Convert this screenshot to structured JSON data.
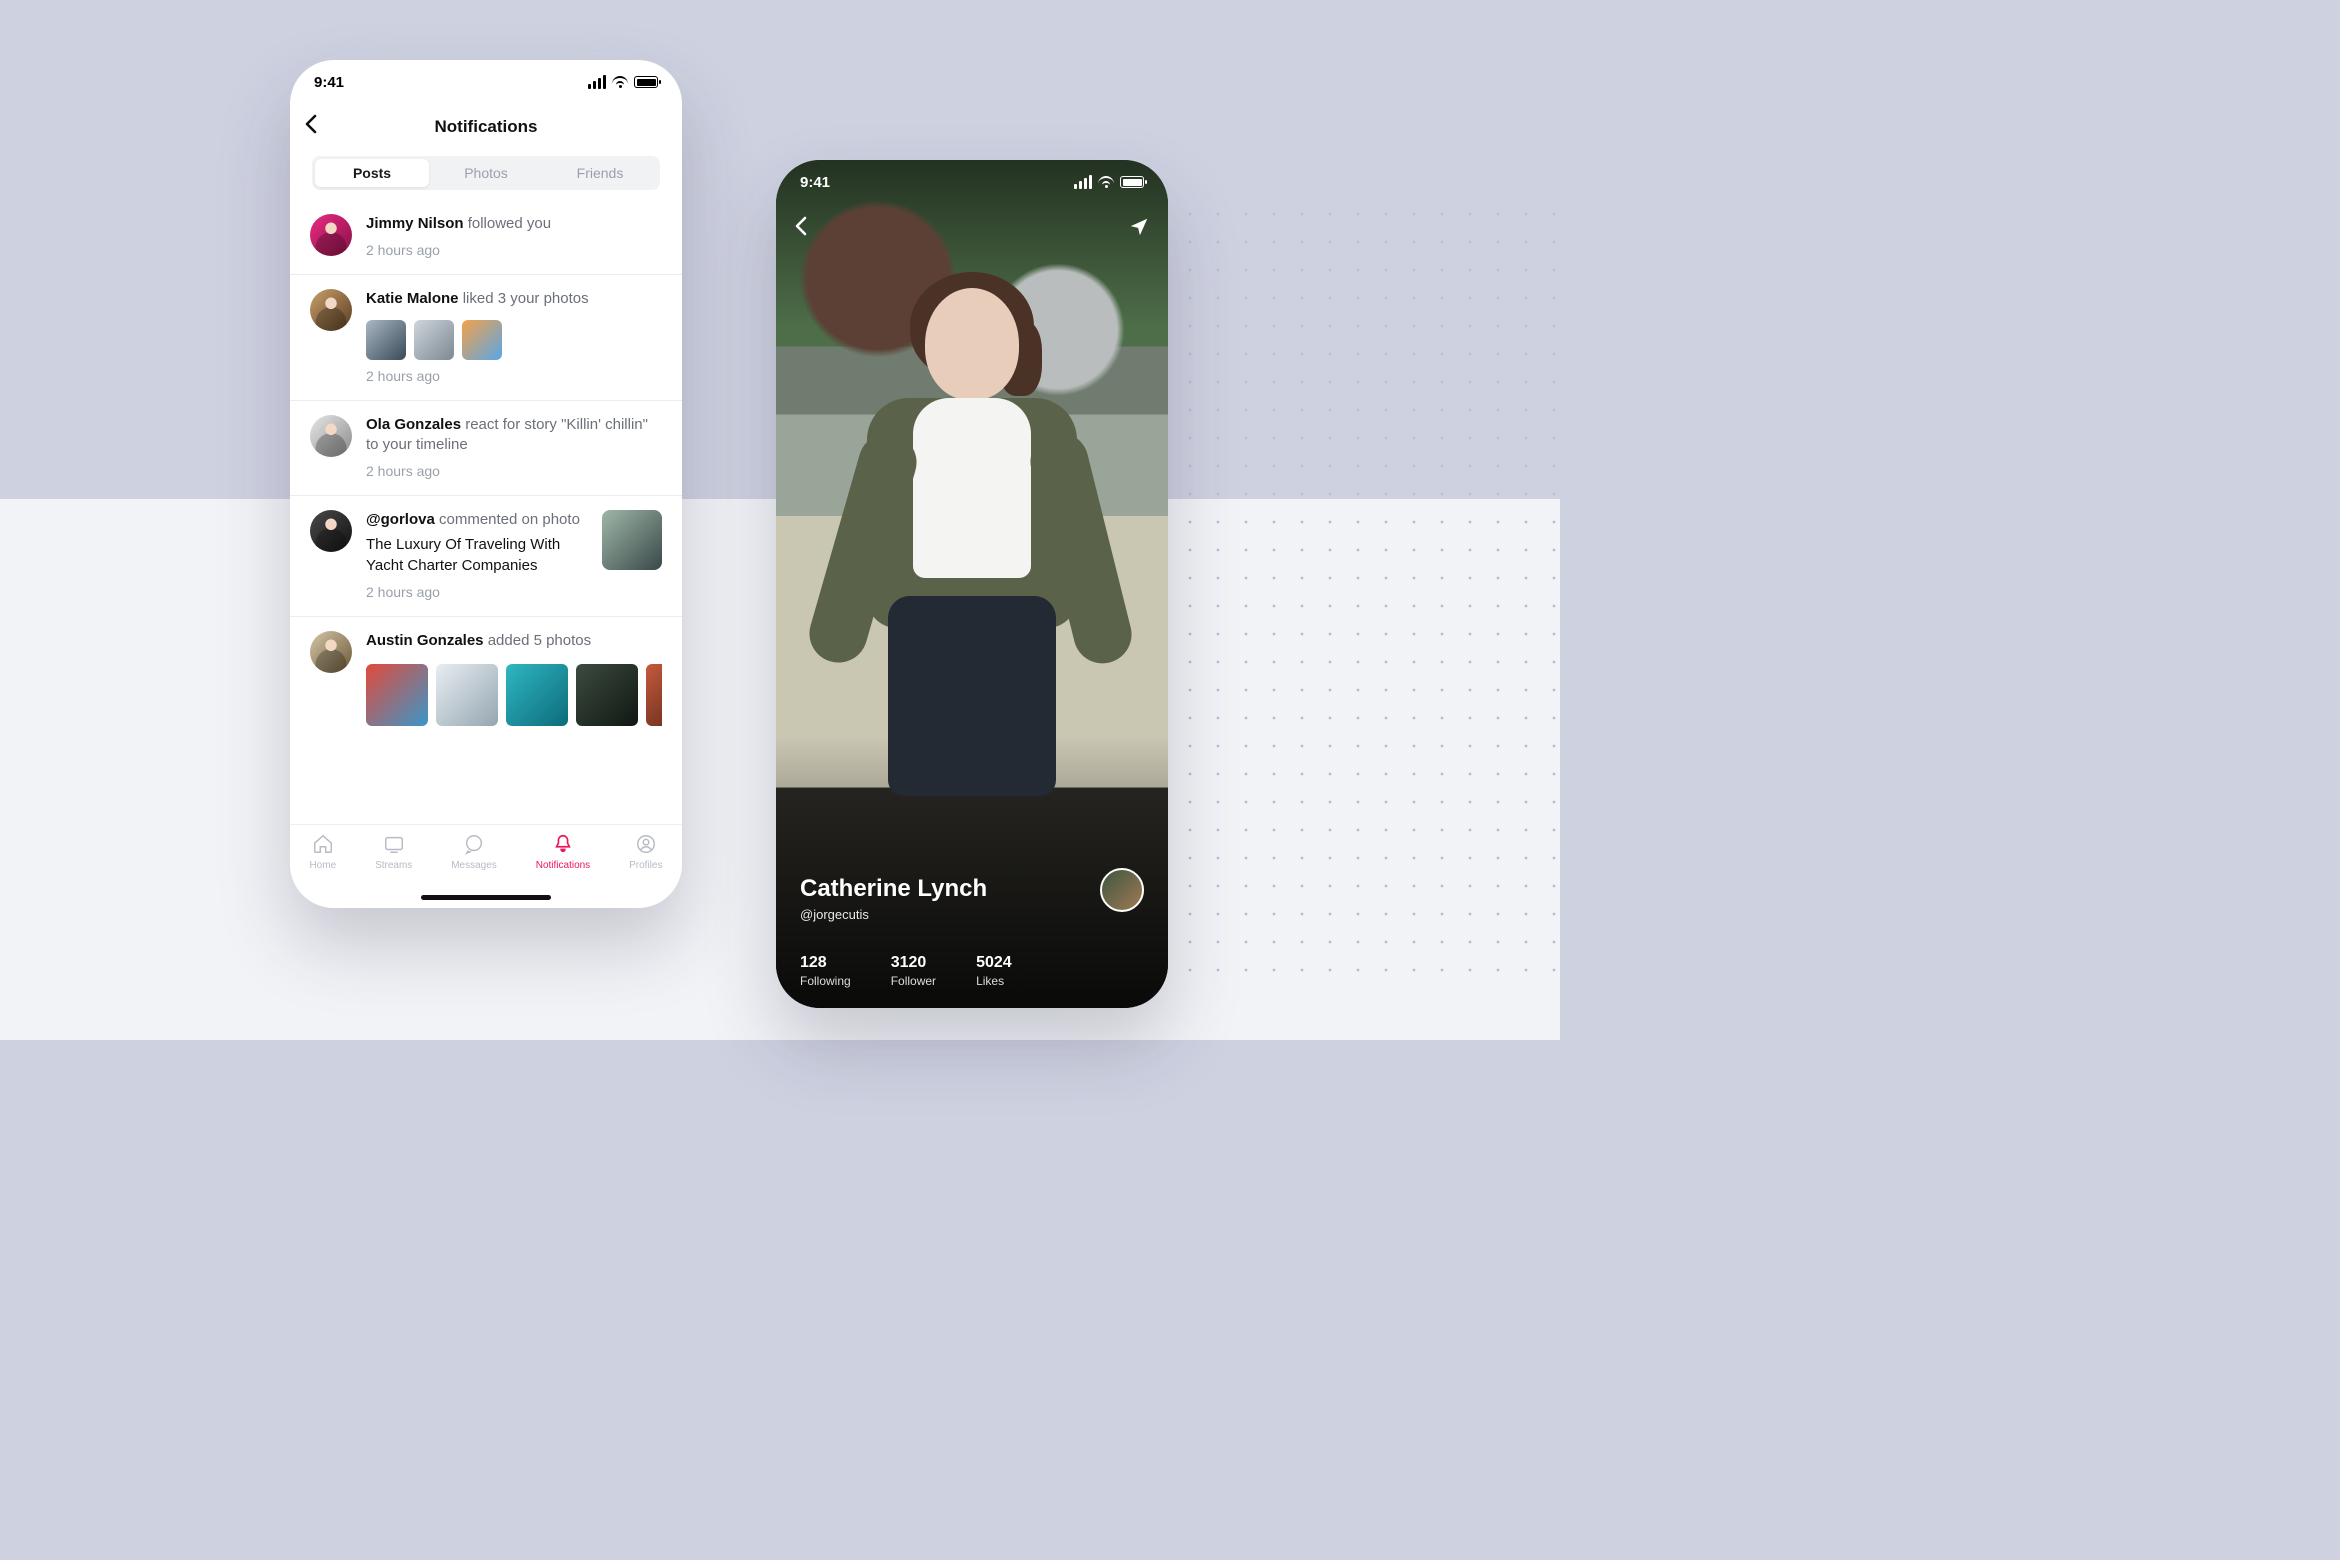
{
  "status": {
    "time": "9:41"
  },
  "notifications": {
    "title": "Notifications",
    "tabs": [
      "Posts",
      "Photos",
      "Friends"
    ],
    "items": [
      {
        "actor": "Jimmy Nilson",
        "action": "followed you",
        "time": "2 hours ago"
      },
      {
        "actor": "Katie Malone",
        "action": "liked 3 your photos",
        "time": "2 hours ago",
        "thumbs": 3
      },
      {
        "actor": "Ola Gonzales",
        "action": "react for story \"Killin' chillin\" to your timeline",
        "time": "2 hours ago"
      },
      {
        "actor": "@gorlova",
        "action": "commented on photo",
        "subtitle": "The Luxury Of Traveling With Yacht Charter Companies",
        "time": "2 hours ago",
        "side_thumb": true
      },
      {
        "actor": "Austin Gonzales",
        "action": "added 5 photos",
        "strip": 5
      }
    ]
  },
  "tabbar": {
    "items": [
      "Home",
      "Streams",
      "Messages",
      "Notifications",
      "Profiles"
    ],
    "active": 3
  },
  "profile": {
    "name": "Catherine Lynch",
    "handle": "@jorgecutis",
    "stats": [
      {
        "n": "128",
        "l": "Following"
      },
      {
        "n": "3120",
        "l": "Follower"
      },
      {
        "n": "5024",
        "l": "Likes"
      }
    ]
  }
}
